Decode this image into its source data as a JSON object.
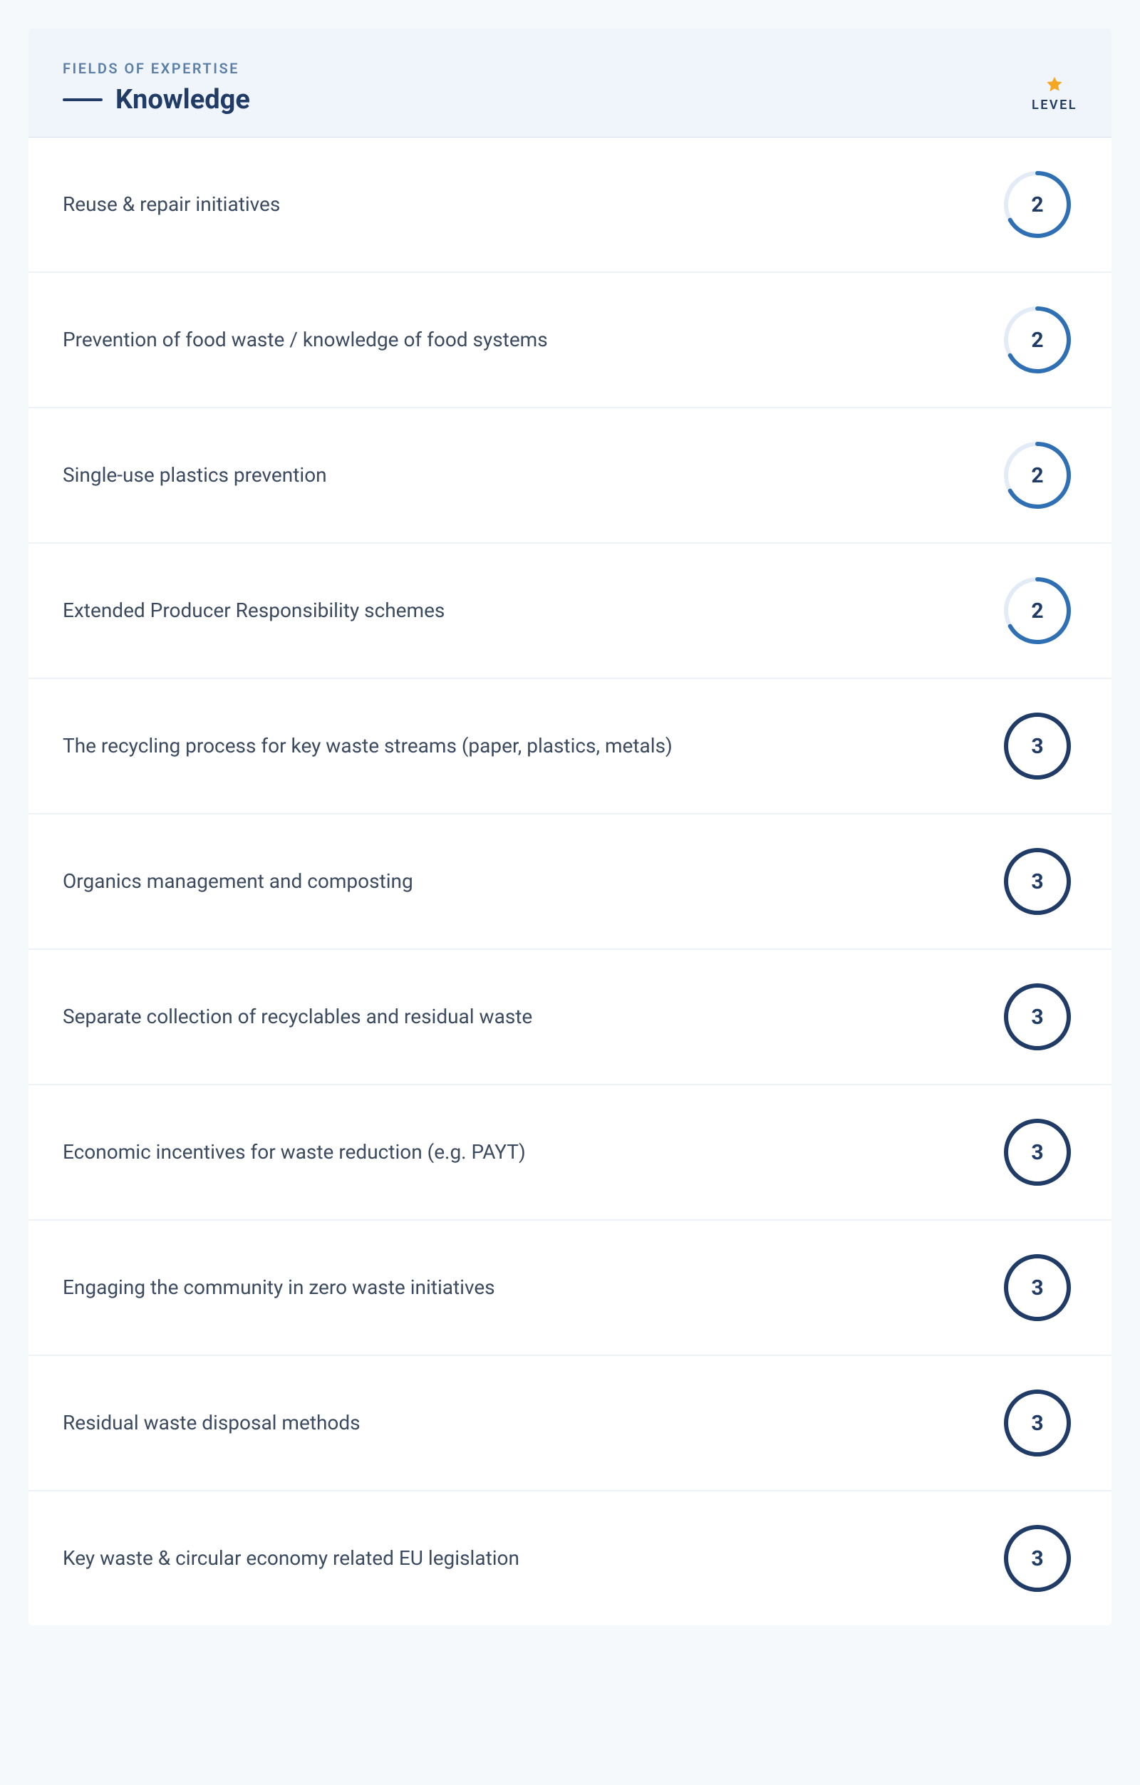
{
  "header": {
    "eyebrow": "FIELDS OF EXPERTISE",
    "title": "Knowledge",
    "level_label": "LEVEL"
  },
  "colors": {
    "ring_track": "#e3ecf6",
    "ring_fill": "#2f6fb3",
    "ring_full": "#1f3b66",
    "star": "#f5a623"
  },
  "max_level": 3,
  "rows": [
    {
      "label": "Reuse & repair initiatives",
      "level": 2
    },
    {
      "label": "Prevention of food waste / knowledge of food systems",
      "level": 2
    },
    {
      "label": "Single-use plastics prevention",
      "level": 2
    },
    {
      "label": "Extended Producer Responsibility schemes",
      "level": 2
    },
    {
      "label": "The recycling process for key waste streams (paper, plastics, metals)",
      "level": 3
    },
    {
      "label": "Organics management and composting",
      "level": 3
    },
    {
      "label": "Separate collection of recyclables and residual waste",
      "level": 3
    },
    {
      "label": "Economic incentives for waste reduction (e.g. PAYT)",
      "level": 3
    },
    {
      "label": "Engaging the community in zero waste initiatives",
      "level": 3
    },
    {
      "label": "Residual waste disposal methods",
      "level": 3
    },
    {
      "label": "Key waste & circular economy related EU legislation",
      "level": 3
    }
  ]
}
